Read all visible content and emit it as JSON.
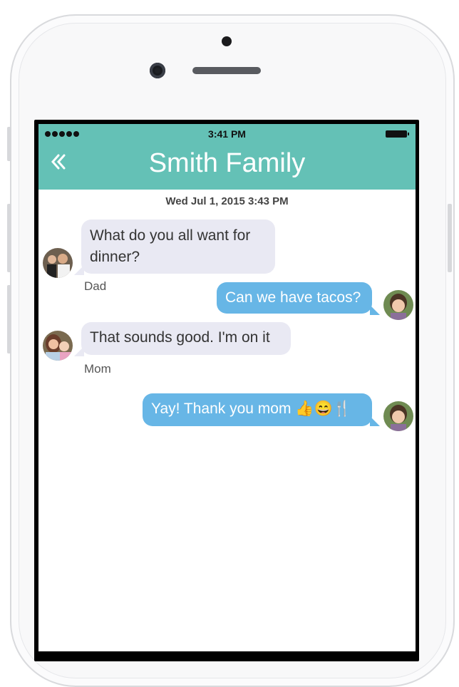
{
  "status_bar": {
    "time": "3:41 PM"
  },
  "nav": {
    "title": "Smith Family",
    "back_icon": "chevron-left-icon"
  },
  "thread": {
    "date": "Wed Jul 1, 2015 3:43 PM"
  },
  "messages": [
    {
      "sender": "Dad",
      "text": "What do you all want for dinner?",
      "direction": "incoming"
    },
    {
      "sender": "",
      "text": "Can we have tacos?",
      "direction": "outgoing"
    },
    {
      "sender": "Mom",
      "text": "That sounds good. I'm on it",
      "direction": "incoming"
    },
    {
      "sender": "",
      "text": "Yay! Thank you mom 👍😄🍴",
      "direction": "outgoing"
    }
  ],
  "colors": {
    "accent": "#64c1b6",
    "incoming_bubble": "#e9e9f3",
    "outgoing_bubble": "#67b6e6"
  }
}
